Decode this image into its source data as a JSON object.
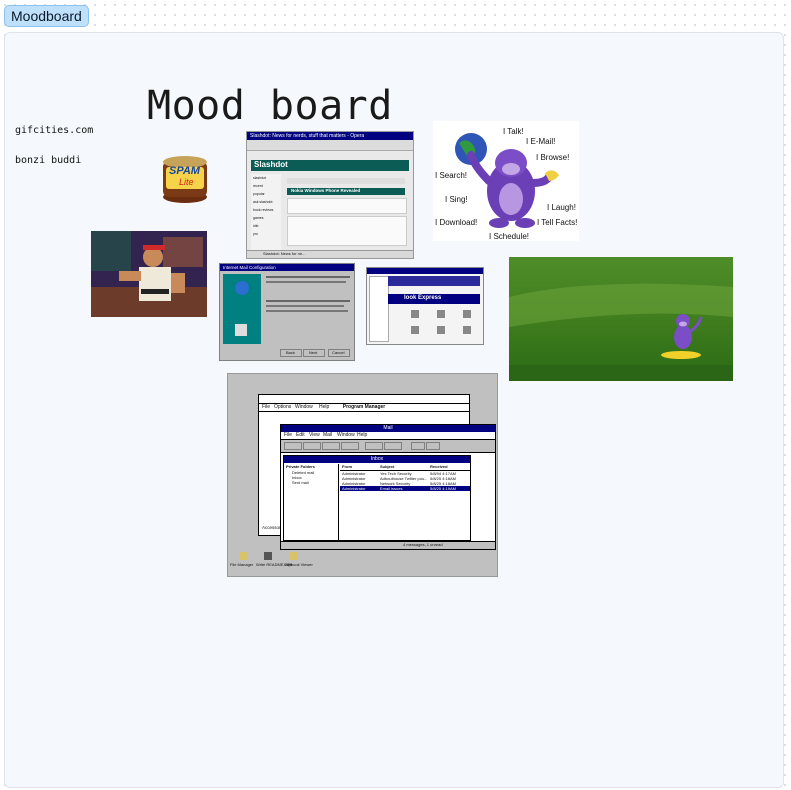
{
  "board": {
    "tag": "Moodboard",
    "title": "Mood board"
  },
  "notes": [
    "gifcities.com",
    "bonzi buddi"
  ],
  "images": {
    "spam": {
      "brand": "SPAM",
      "sub": "Lite"
    },
    "slashdot": {
      "window_title": "Slashdot: News for nerds, stuff that matters - Opera",
      "logo": "Slashdot",
      "headline": "Nokia Windows Phone Revealed",
      "tabs": [
        "Slashdot: News for ne..."
      ],
      "sidebar": [
        "slashdot",
        "recent",
        "popular",
        "ask slashdot",
        "book reviews",
        "games",
        "idle",
        "yro"
      ]
    },
    "bonzi": {
      "speech": [
        "I Talk!",
        "I E-Mail!",
        "I Browse!",
        "I Search!",
        "I Sing!",
        "I Laugh!",
        "I Download!",
        "I Tell Facts!",
        "I Schedule!"
      ]
    },
    "ie_config": {
      "window_title": "Internet Mail Configuration",
      "buttons": [
        "Back",
        "Next",
        "Cancel"
      ]
    },
    "outlook": {
      "title_text": "look Express"
    },
    "win31": {
      "program_manager": "Program Manager",
      "pm_menu": [
        "File",
        "Options",
        "Window",
        "Help"
      ],
      "mail_title": "Mail",
      "mail_menu": [
        "File",
        "Edit",
        "View",
        "Mail",
        "Window",
        "Help"
      ],
      "inbox_title": "Inbox",
      "folders_header": "Private Folders",
      "folders": [
        "Deleted mail",
        "Inbox",
        "Sent mail"
      ],
      "columns": [
        "From",
        "Subject",
        "Received"
      ],
      "rows": [
        [
          "Administrator",
          "Yes Tech Security",
          "5/8/94 4:17AM"
        ],
        [
          "Administrator",
          "Adbouthouse Twitter pos...",
          "5/8/25 4:18AM"
        ],
        [
          "Administrator",
          "Network Security",
          "5/8/25 4:18AM"
        ],
        [
          "Administrator",
          "Email issues",
          "5/8/25 4:19AM"
        ]
      ],
      "status": "4 messages, 1 unread",
      "desktop_icons": [
        "File Manager",
        "Write README.WRI",
        "Clipbook Viewer"
      ],
      "accessories": "Accessori"
    }
  }
}
